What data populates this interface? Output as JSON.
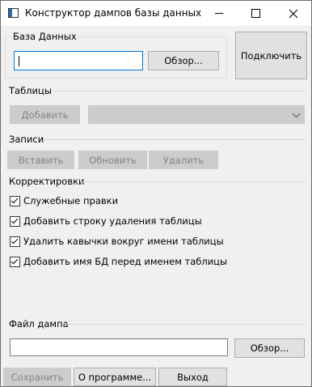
{
  "window": {
    "title": "Конструктор дампов базы данных"
  },
  "database": {
    "label": "База Данных",
    "path_value": "",
    "browse_label": "Обзор...",
    "connect_label": "Подключить"
  },
  "tables": {
    "label": "Таблицы",
    "add_label": "Добавить",
    "select_value": ""
  },
  "records": {
    "label": "Записи",
    "insert_label": "Вставить",
    "update_label": "Обновить",
    "delete_label": "Удалить"
  },
  "corrections": {
    "label": "Корректировки",
    "options": [
      {
        "label": "Служебные правки",
        "checked": true
      },
      {
        "label": "Добавить строку удаления таблицы",
        "checked": true
      },
      {
        "label": "Удалить кавычки вокруг имени таблицы",
        "checked": true
      },
      {
        "label": "Добавить имя БД перед именем таблицы",
        "checked": true
      }
    ]
  },
  "dump_file": {
    "label": "Файл дампа",
    "path_value": "",
    "browse_label": "Обзор..."
  },
  "footer": {
    "save_label": "Сохранить",
    "about_label": "О программе...",
    "exit_label": "Выход"
  }
}
